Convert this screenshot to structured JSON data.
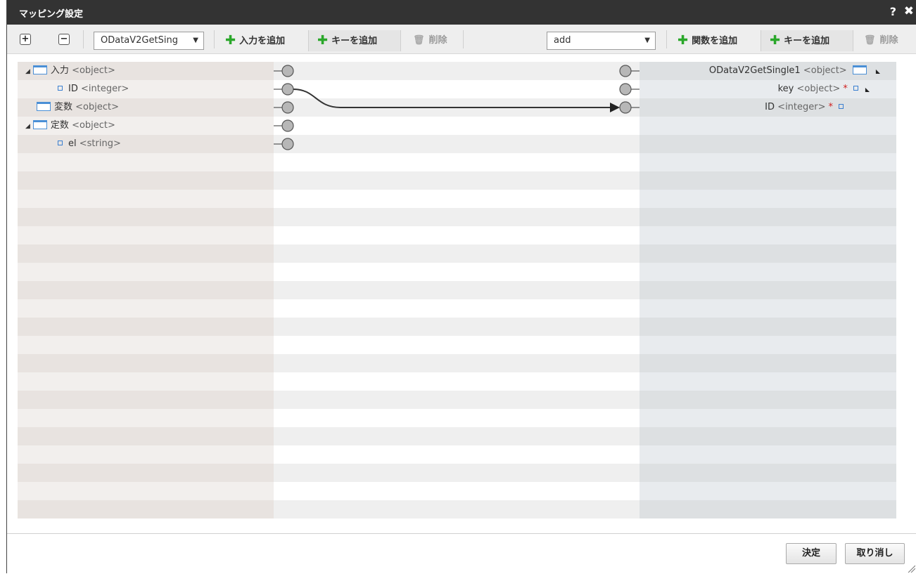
{
  "dialog": {
    "title": "マッピング設定",
    "help": "?",
    "close": "✖"
  },
  "toolbar": {
    "expand": "+",
    "collapse": "−",
    "source_select": "ODataV2GetSing",
    "source_add_input": "入力を追加",
    "source_add_key": "キーを追加",
    "source_delete": "削除",
    "target_select": "add",
    "target_add_function": "関数を追加",
    "target_add_key": "キーを追加",
    "target_delete": "削除"
  },
  "source_tree": [
    {
      "name": "入力",
      "type": "<object>"
    },
    {
      "name": "ID",
      "type": "<integer>"
    },
    {
      "name": "変数",
      "type": "<object>"
    },
    {
      "name": "定数",
      "type": "<object>"
    },
    {
      "name": "el",
      "type": "<string>"
    }
  ],
  "target_tree": [
    {
      "name": "ODataV2GetSingle1",
      "type": "<object>"
    },
    {
      "name": "key",
      "type": "<object>",
      "required": "*"
    },
    {
      "name": "ID",
      "type": "<integer>",
      "required": "*"
    }
  ],
  "footer": {
    "ok": "決定",
    "cancel": "取り消し"
  },
  "icons": {
    "expand-arrow": "◢",
    "object": "object-icon",
    "field": "field-icon",
    "corner": "◣"
  },
  "colors": {
    "accent_green": "#2aa72a",
    "icon_blue": "#4a8fd6",
    "required_red": "#d02020",
    "titlebar": "#333333"
  }
}
